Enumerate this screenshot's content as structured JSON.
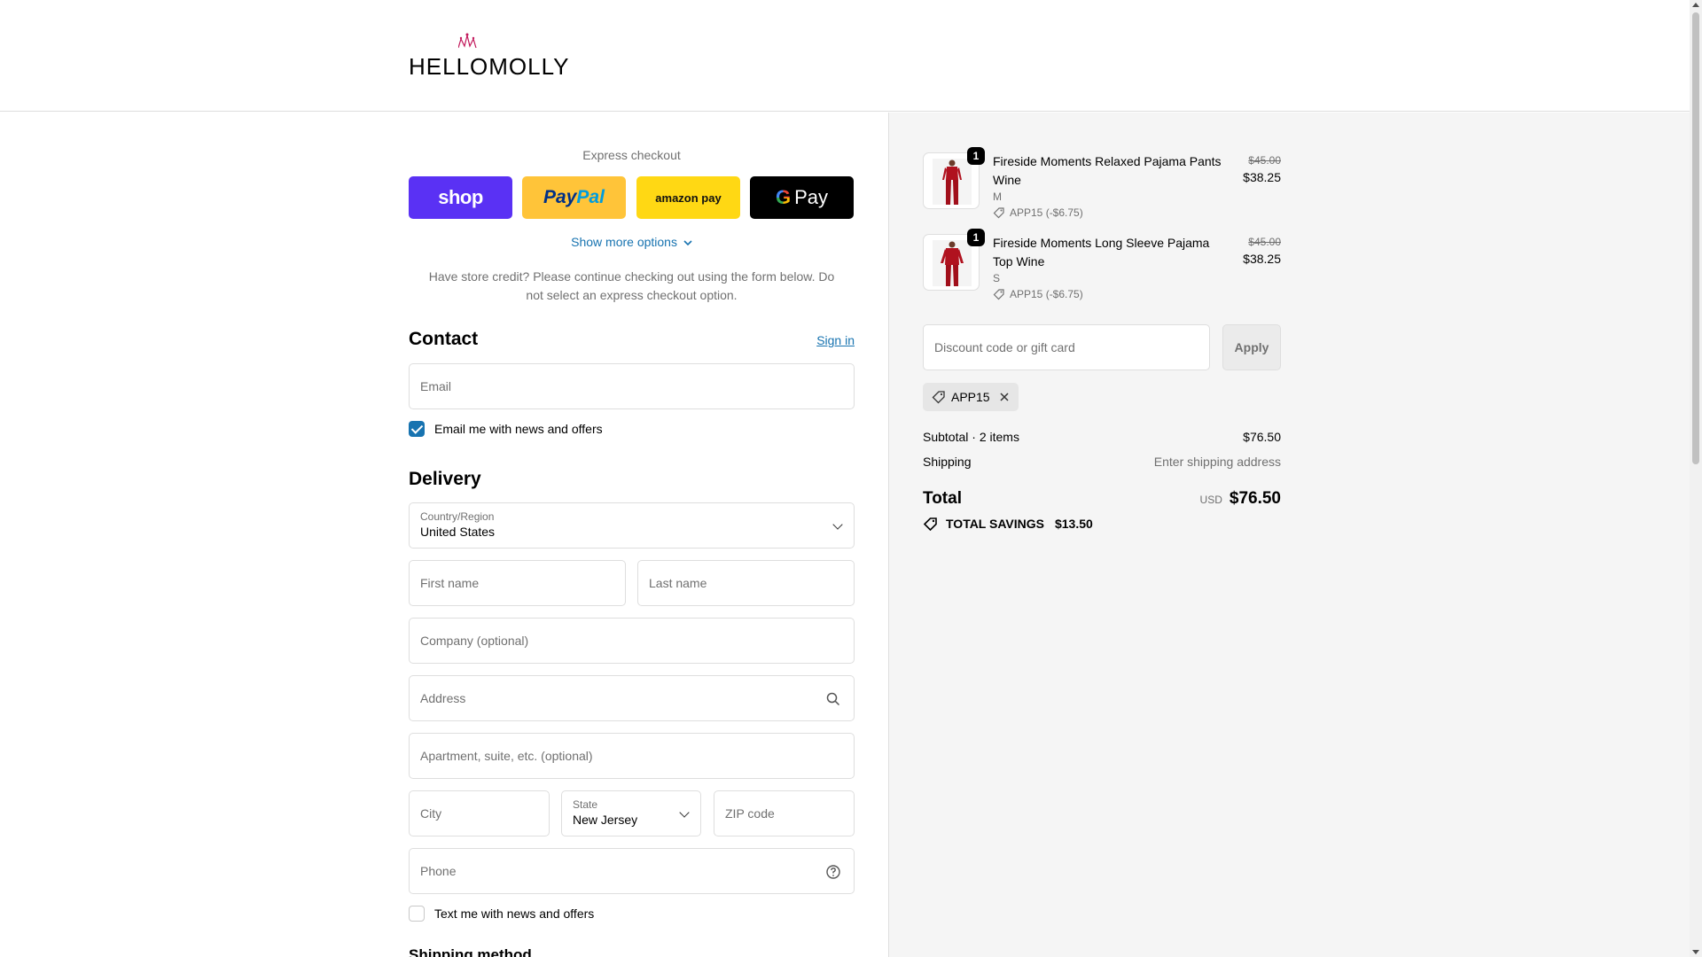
{
  "header": {
    "logo_text": "HELLOMOLLY"
  },
  "express": {
    "title": "Express checkout",
    "shop_label": "shop",
    "paypal_part1": "Pay",
    "paypal_part2": "Pal",
    "amazon_label": "amazon pay",
    "gpay_g": "G",
    "gpay_label": "Pay",
    "more_options": "Show more options",
    "store_credit_note": "Have store credit? Please continue checking out using the form below. Do not select an express checkout option."
  },
  "contact": {
    "title": "Contact",
    "sign_in": "Sign in",
    "email_placeholder": "Email",
    "news_checkbox_label": "Email me with news and offers",
    "news_checked": true
  },
  "delivery": {
    "title": "Delivery",
    "country_label": "Country/Region",
    "country_value": "United States",
    "first_name_placeholder": "First name",
    "last_name_placeholder": "Last name",
    "company_placeholder": "Company (optional)",
    "address_placeholder": "Address",
    "apartment_placeholder": "Apartment, suite, etc. (optional)",
    "city_placeholder": "City",
    "state_label": "State",
    "state_value": "New Jersey",
    "zip_placeholder": "ZIP code",
    "phone_placeholder": "Phone",
    "text_checkbox_label": "Text me with news and offers",
    "text_checked": false
  },
  "shipping_method": {
    "title": "Shipping method"
  },
  "order": {
    "products": [
      {
        "quantity": "1",
        "name": "Fireside Moments Relaxed Pajama Pants Wine",
        "variant": "M",
        "discount": "APP15 (-$6.75)",
        "old_price": "$45.00",
        "price": "$38.25"
      },
      {
        "quantity": "1",
        "name": "Fireside Moments Long Sleeve Pajama Top Wine",
        "variant": "S",
        "discount": "APP15 (-$6.75)",
        "old_price": "$45.00",
        "price": "$38.25"
      }
    ],
    "discount_placeholder": "Discount code or gift card",
    "apply_label": "Apply",
    "applied_code": "APP15",
    "subtotal_label": "Subtotal · 2 items",
    "subtotal_value": "$76.50",
    "shipping_label": "Shipping",
    "shipping_value": "Enter shipping address",
    "total_label": "Total",
    "currency": "USD",
    "total_value": "$76.50",
    "savings_label": "TOTAL SAVINGS",
    "savings_value": "$13.50"
  },
  "colors": {
    "accent_link": "#1773b0",
    "shop_pay": "#5a31f4",
    "paypal": "#ffc439",
    "amazon_pay": "#ffd814",
    "gpay": "#000000",
    "summary_bg": "#f5f5f5",
    "product_red": "#b0121f"
  }
}
